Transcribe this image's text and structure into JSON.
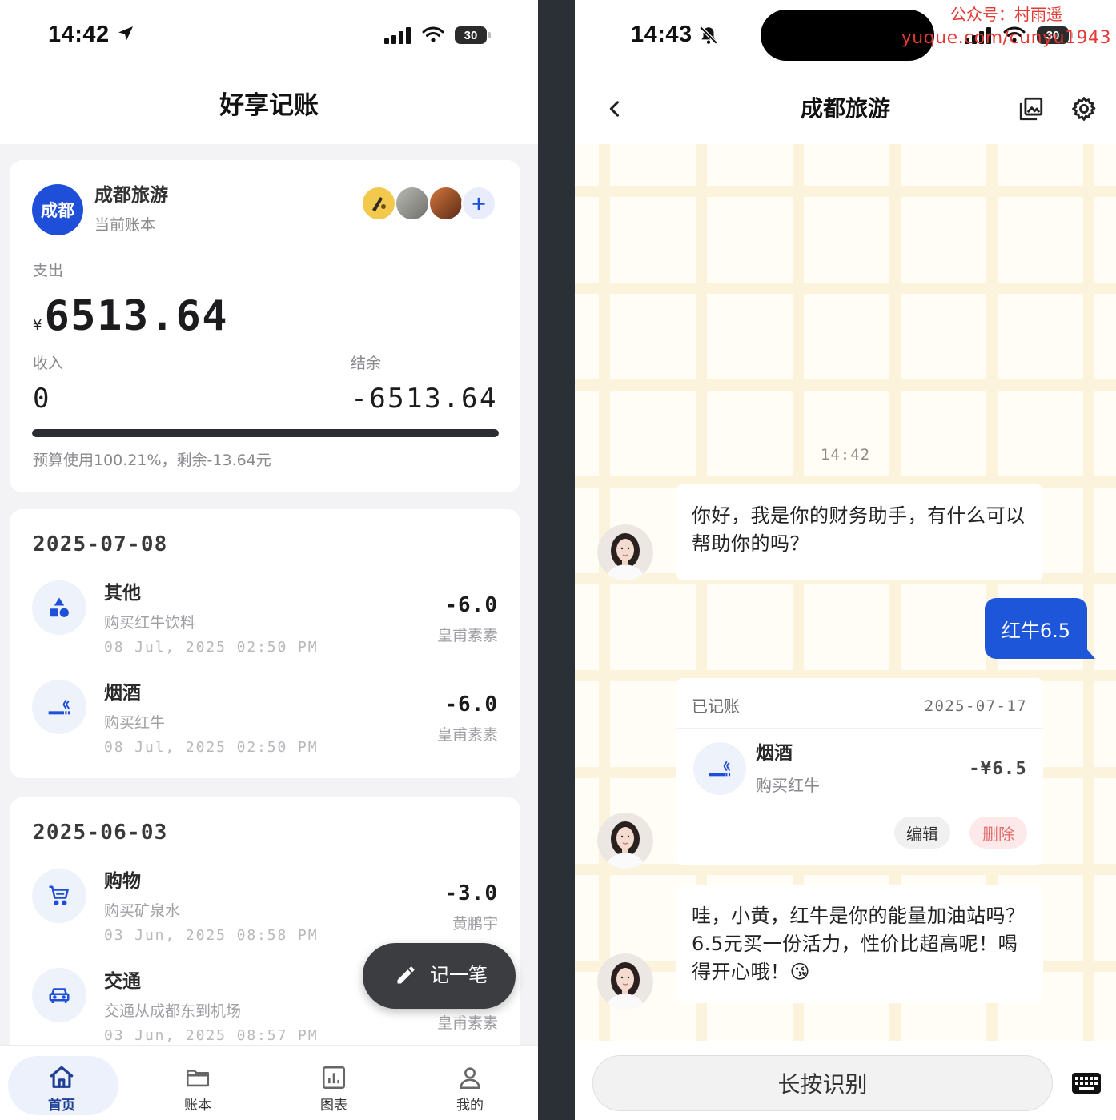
{
  "colors": {
    "brand": "#1f4fd8",
    "nav_active": "#1f3f95",
    "user_bubble": "#1e56d9",
    "fab": "#3b3d41",
    "danger": "#e26d6d",
    "watermark": "#e53935"
  },
  "left": {
    "status_bar": {
      "time": "14:42",
      "battery": "30",
      "icons": [
        "location-arrow-icon",
        "signal-icon",
        "wifi-icon",
        "battery-icon"
      ]
    },
    "app_title": "好享记账",
    "book": {
      "badge": "成都",
      "name": "成都旅游",
      "subtitle": "当前账本",
      "add_member": "+"
    },
    "summary": {
      "expense_label": "支出",
      "currency": "¥",
      "expense": "6513.64",
      "income_label": "收入",
      "income": "0",
      "balance_label": "结余",
      "balance": "-6513.64",
      "budget_progress": 1.0,
      "budget_text": "预算使用100.21%，剩余-13.64元"
    },
    "groups": [
      {
        "date": "2025-07-08",
        "items": [
          {
            "category": "其他",
            "icon": "shapes-icon",
            "note": "购买红牛饮料",
            "time": "08 Jul, 2025 02:50 PM",
            "amount": "-6.0",
            "member": "皇甫素素"
          },
          {
            "category": "烟酒",
            "icon": "smoking-icon",
            "note": "购买红牛",
            "time": "08 Jul, 2025 02:50 PM",
            "amount": "-6.0",
            "member": "皇甫素素"
          }
        ]
      },
      {
        "date": "2025-06-03",
        "items": [
          {
            "category": "购物",
            "icon": "cart-icon",
            "note": "购买矿泉水",
            "time": "03 Jun, 2025 08:58 PM",
            "amount": "-3.0",
            "member": "黄鹏宇"
          },
          {
            "category": "交通",
            "icon": "car-icon",
            "note": "交通从成都东到机场",
            "time": "03 Jun, 2025 08:57 PM",
            "member": "皇甫素素"
          }
        ]
      }
    ],
    "fab": {
      "label": "记一笔",
      "icon": "pencil-icon"
    },
    "nav": [
      {
        "label": "首页",
        "icon": "home-icon",
        "active": true
      },
      {
        "label": "账本",
        "icon": "folder-icon",
        "active": false
      },
      {
        "label": "图表",
        "icon": "chart-icon",
        "active": false
      },
      {
        "label": "我的",
        "icon": "person-icon",
        "active": false
      }
    ]
  },
  "right": {
    "status_bar": {
      "time": "14:43",
      "battery": "30",
      "icons": [
        "bell-slash-icon",
        "signal-icon",
        "wifi-icon",
        "battery-icon"
      ]
    },
    "watermark": {
      "line1": "公众号：村雨遥",
      "line2": "yuque.com/cunyu1943"
    },
    "header": {
      "title": "成都旅游",
      "icons": [
        "back-icon",
        "image-icon",
        "gear-icon"
      ]
    },
    "chat": {
      "timestamp": "14:42",
      "greeting_lines": [
        "你好，我是你的财务助手，有什么可以",
        "帮助你的吗？"
      ],
      "user_message": "红牛6.5",
      "record": {
        "status": "已记账",
        "date": "2025-07-17",
        "category": "烟酒",
        "icon": "smoking-icon",
        "note": "购买红牛",
        "amount": "-¥6.5",
        "edit_label": "编辑",
        "delete_label": "删除"
      },
      "reply_lines": [
        "哇，小黄，红牛是你的能量加油站吗？",
        "6.5元买一份活力，性价比超高呢！喝",
        "得开心哦！😘"
      ]
    },
    "input": {
      "voice_label": "长按识别",
      "keyboard_icon": "keyboard-icon"
    }
  }
}
